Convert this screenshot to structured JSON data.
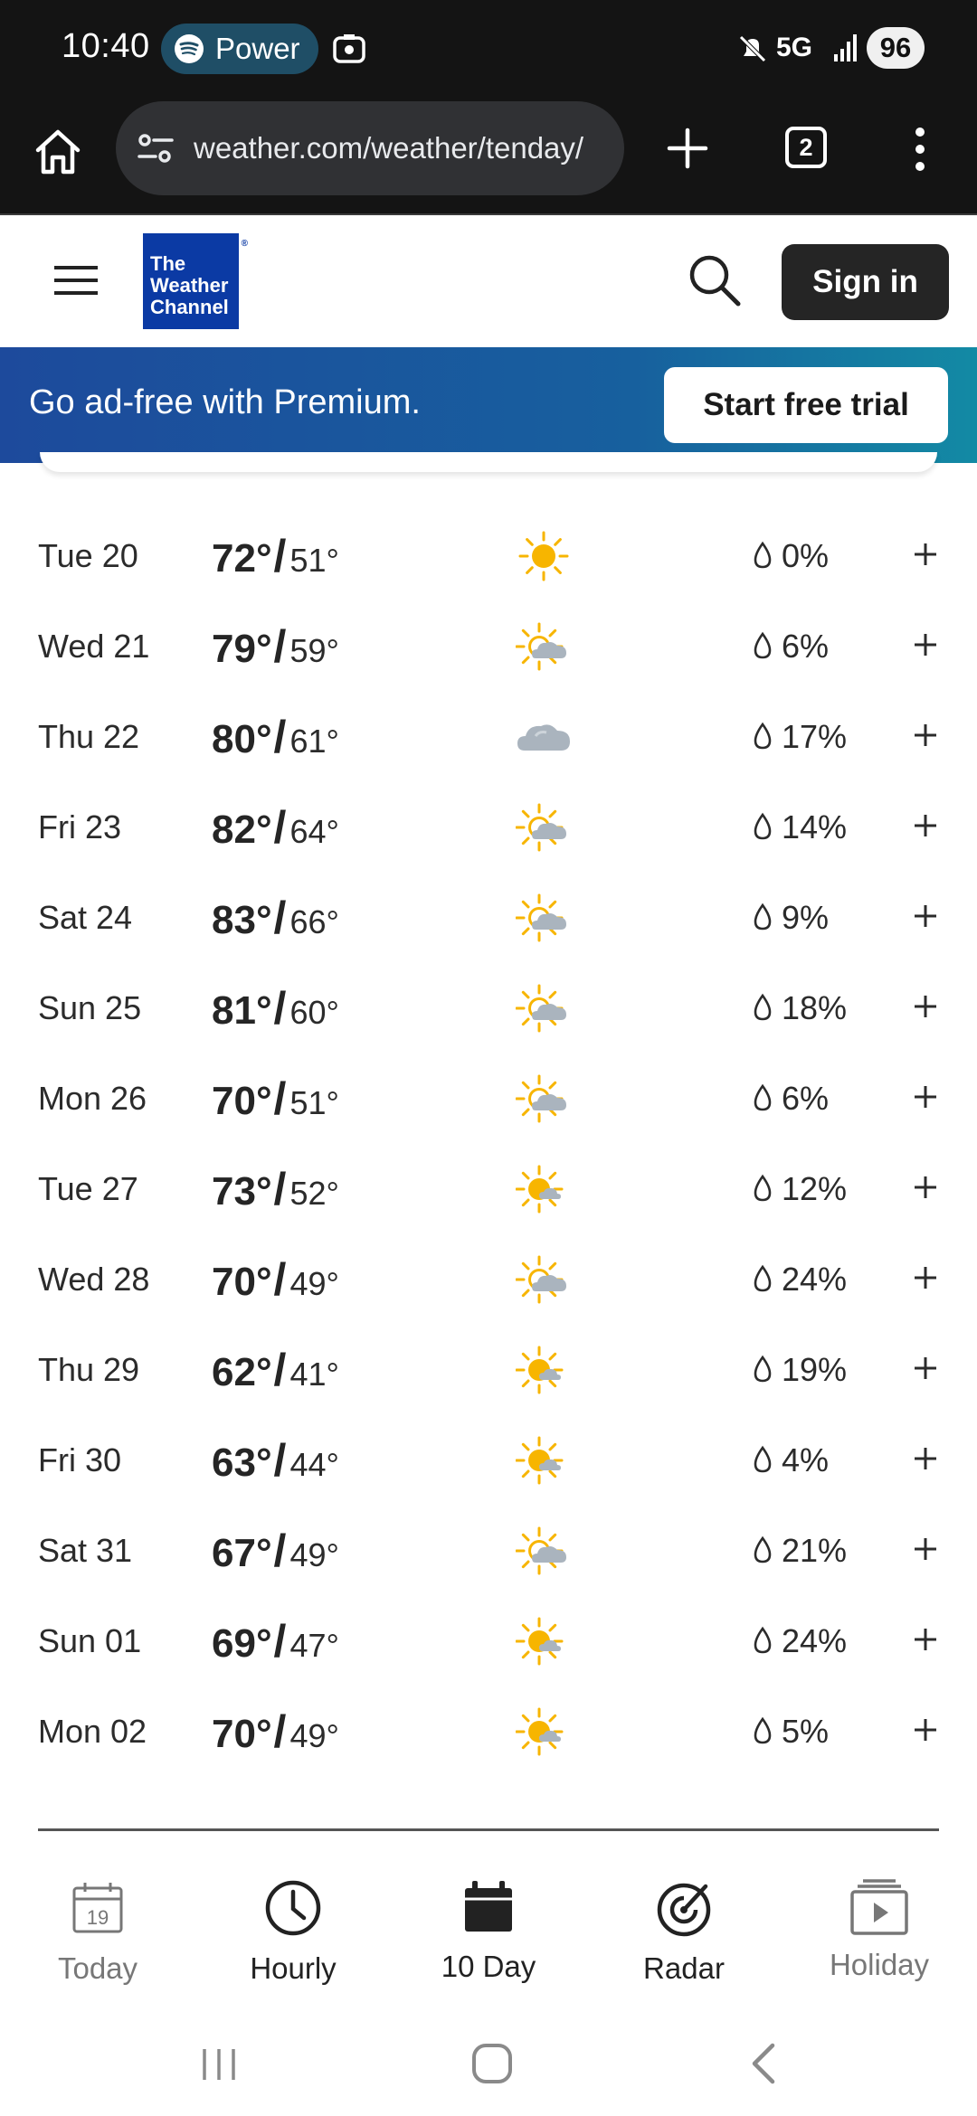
{
  "status_bar": {
    "time": "10:40",
    "media_app": "Power",
    "network": "5G",
    "battery": "96"
  },
  "browser": {
    "url": "weather.com/weather/tenday/",
    "tab_count": "2"
  },
  "site_header": {
    "logo_lines": [
      "The",
      "Weather",
      "Channel"
    ],
    "sign_in_label": "Sign in"
  },
  "premium_banner": {
    "text": "Go ad-free with Premium.",
    "button_label": "Start free trial"
  },
  "forecast": [
    {
      "day": "Tue 20",
      "high": "72°",
      "low": "51°",
      "icon": "sunny-icon",
      "precip": "0%"
    },
    {
      "day": "Wed 21",
      "high": "79°",
      "low": "59°",
      "icon": "partly-cloudy-icon",
      "precip": "6%"
    },
    {
      "day": "Thu 22",
      "high": "80°",
      "low": "61°",
      "icon": "cloudy-icon",
      "precip": "17%"
    },
    {
      "day": "Fri 23",
      "high": "82°",
      "low": "64°",
      "icon": "partly-cloudy-icon",
      "precip": "14%"
    },
    {
      "day": "Sat 24",
      "high": "83°",
      "low": "66°",
      "icon": "partly-cloudy-icon",
      "precip": "9%"
    },
    {
      "day": "Sun 25",
      "high": "81°",
      "low": "60°",
      "icon": "partly-cloudy-icon",
      "precip": "18%"
    },
    {
      "day": "Mon 26",
      "high": "70°",
      "low": "51°",
      "icon": "partly-cloudy-icon",
      "precip": "6%"
    },
    {
      "day": "Tue 27",
      "high": "73°",
      "low": "52°",
      "icon": "mostly-sunny-icon",
      "precip": "12%"
    },
    {
      "day": "Wed 28",
      "high": "70°",
      "low": "49°",
      "icon": "partly-cloudy-icon",
      "precip": "24%"
    },
    {
      "day": "Thu 29",
      "high": "62°",
      "low": "41°",
      "icon": "mostly-sunny-icon",
      "precip": "19%"
    },
    {
      "day": "Fri 30",
      "high": "63°",
      "low": "44°",
      "icon": "mostly-sunny-icon",
      "precip": "4%"
    },
    {
      "day": "Sat 31",
      "high": "67°",
      "low": "49°",
      "icon": "partly-cloudy-icon",
      "precip": "21%"
    },
    {
      "day": "Sun 01",
      "high": "69°",
      "low": "47°",
      "icon": "mostly-sunny-icon",
      "precip": "24%"
    },
    {
      "day": "Mon 02",
      "high": "70°",
      "low": "49°",
      "icon": "mostly-sunny-icon",
      "precip": "5%"
    }
  ],
  "bottom_nav": {
    "today": {
      "label": "Today",
      "calendar_day": "19"
    },
    "hourly": {
      "label": "Hourly"
    },
    "ten_day": {
      "label": "10 Day"
    },
    "radar": {
      "label": "Radar"
    },
    "holiday": {
      "label": "Holiday"
    }
  },
  "colors": {
    "sun": "#f7b500",
    "cloud": "#aab4be",
    "active_nav": "#222222",
    "inactive_nav": "#777777"
  }
}
